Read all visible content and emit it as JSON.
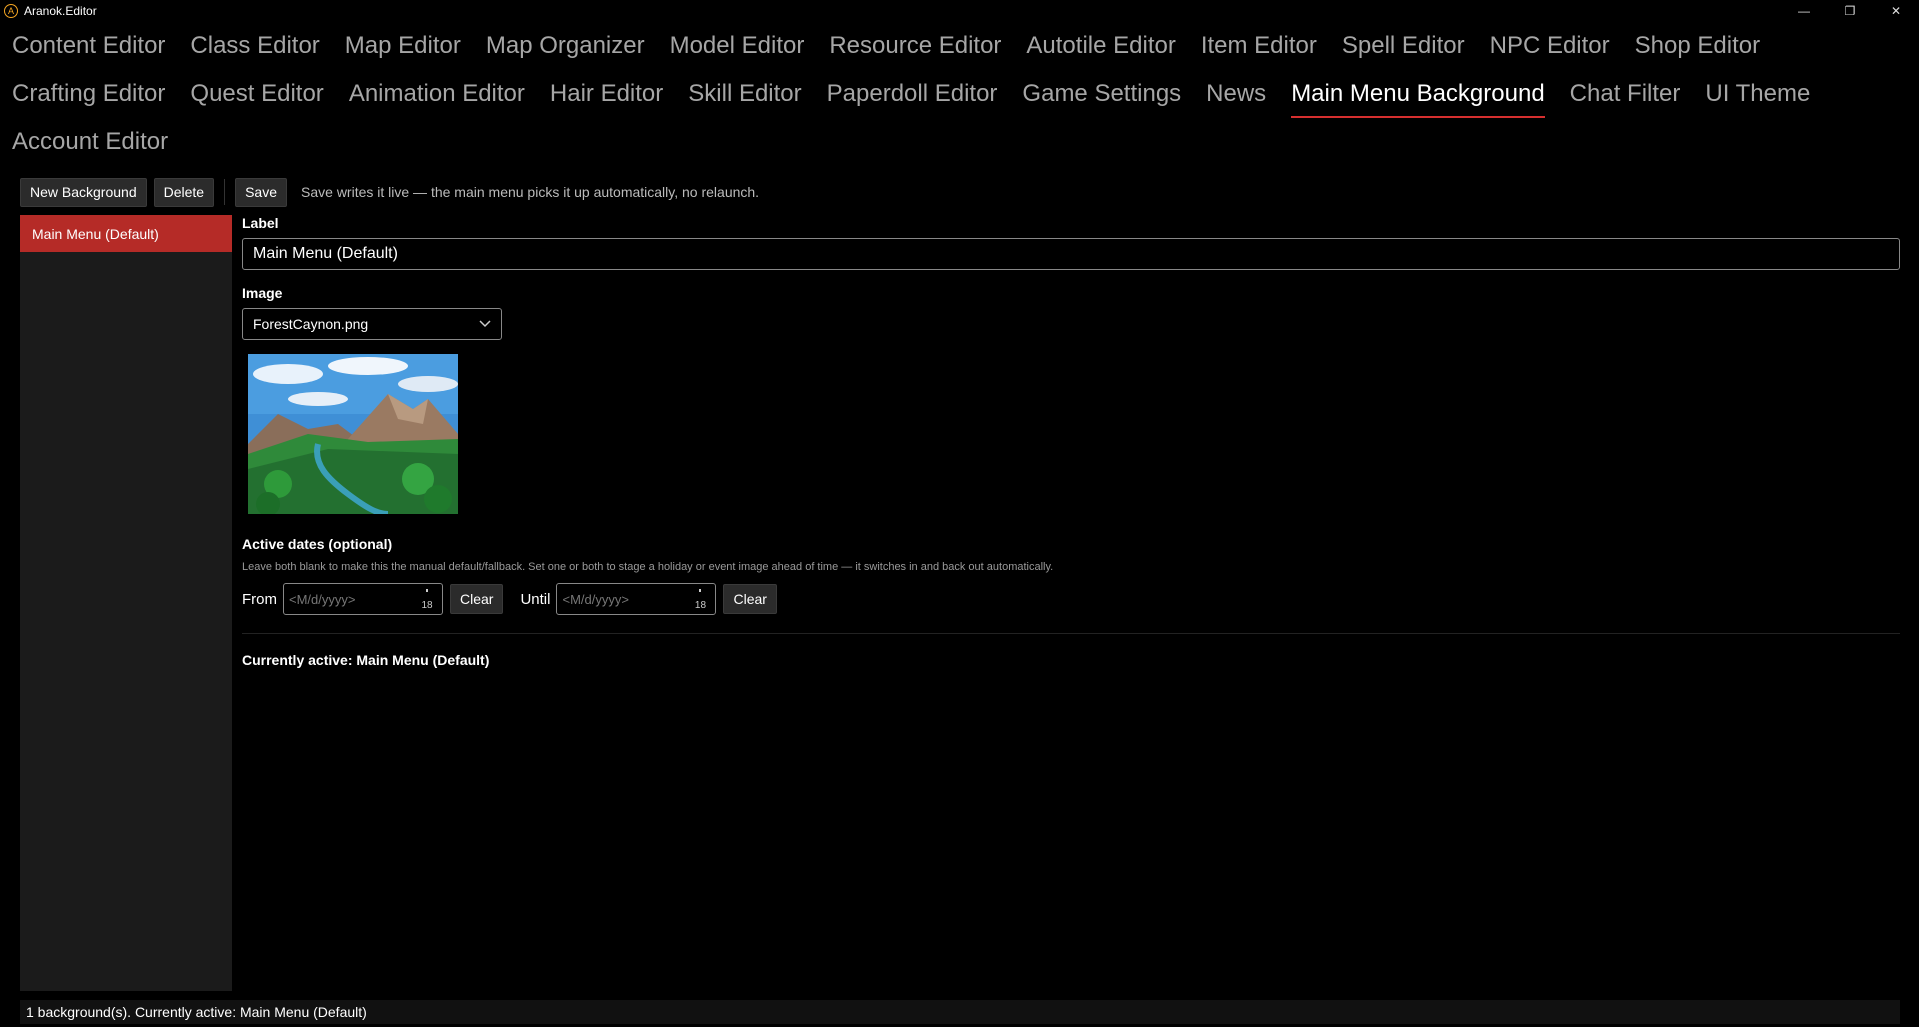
{
  "window": {
    "title": "Aranok.Editor",
    "logo_glyph": "A",
    "controls": {
      "minimize": "—",
      "maximize": "❐",
      "close": "✕"
    }
  },
  "tabs": [
    {
      "label": "Content Editor",
      "active": false
    },
    {
      "label": "Class Editor",
      "active": false
    },
    {
      "label": "Map Editor",
      "active": false
    },
    {
      "label": "Map Organizer",
      "active": false
    },
    {
      "label": "Model Editor",
      "active": false
    },
    {
      "label": "Resource Editor",
      "active": false
    },
    {
      "label": "Autotile Editor",
      "active": false
    },
    {
      "label": "Item Editor",
      "active": false
    },
    {
      "label": "Spell Editor",
      "active": false
    },
    {
      "label": "NPC Editor",
      "active": false
    },
    {
      "label": "Shop Editor",
      "active": false
    },
    {
      "label": "Crafting Editor",
      "active": false
    },
    {
      "label": "Quest Editor",
      "active": false
    },
    {
      "label": "Animation Editor",
      "active": false
    },
    {
      "label": "Hair Editor",
      "active": false
    },
    {
      "label": "Skill Editor",
      "active": false
    },
    {
      "label": "Paperdoll Editor",
      "active": false
    },
    {
      "label": "Game Settings",
      "active": false
    },
    {
      "label": "News",
      "active": false
    },
    {
      "label": "Main Menu Background",
      "active": true
    },
    {
      "label": "Chat Filter",
      "active": false
    },
    {
      "label": "UI Theme",
      "active": false
    },
    {
      "label": "Account Editor",
      "active": false
    }
  ],
  "toolbar": {
    "new_label": "New Background",
    "delete_label": "Delete",
    "save_label": "Save",
    "hint": "Save writes it live — the main menu picks it up automatically, no relaunch."
  },
  "sidebar": {
    "items": [
      {
        "label": "Main Menu (Default)",
        "selected": true
      }
    ]
  },
  "form": {
    "label_heading": "Label",
    "label_value": "Main Menu (Default)",
    "image_heading": "Image",
    "image_value": "ForestCaynon.png",
    "active_dates_heading": "Active dates (optional)",
    "active_dates_hint": "Leave both blank to make this the manual default/fallback. Set one or both to stage a holiday or event image ahead of time — it switches in and back out automatically.",
    "from_label": "From",
    "from_placeholder": "<M/d/yyyy>",
    "from_calendar_day": "18",
    "from_clear": "Clear",
    "until_label": "Until",
    "until_placeholder": "<M/d/yyyy>",
    "until_calendar_day": "18",
    "until_clear": "Clear",
    "currently_active": "Currently active: Main Menu (Default)"
  },
  "status": {
    "text": "1 background(s). Currently active: Main Menu (Default)"
  },
  "colors": {
    "accent": "#b52b27",
    "active_tab_underline": "#d62f2f",
    "background": "#000000"
  }
}
